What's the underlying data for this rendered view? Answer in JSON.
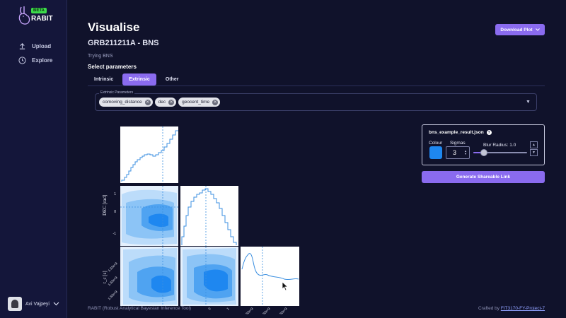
{
  "app": {
    "logo_text": "RABIT",
    "beta_badge": "BETA"
  },
  "sidebar": {
    "items": [
      {
        "label": "Upload",
        "icon": "upload-icon"
      },
      {
        "label": "Explore",
        "icon": "explore-icon"
      }
    ],
    "user": {
      "name": "Avi Vajpeyi"
    }
  },
  "header": {
    "title": "Visualise",
    "download_label": "Download Plot"
  },
  "main": {
    "subtitle": "GRB211211A - BNS",
    "description": "Trying BNS",
    "select_label": "Select parameters",
    "tabs": [
      {
        "label": "Intrinsic",
        "active": false
      },
      {
        "label": "Extrinsic",
        "active": true
      },
      {
        "label": "Other",
        "active": false
      }
    ],
    "param_legend": "Extrinsic Parameters",
    "chips": [
      "comoving_distance",
      "dec",
      "geocent_time"
    ]
  },
  "plot": {
    "ylabel_dec": "DEC [rad]",
    "ylabel_tc": "t_c [s]",
    "dec_ticks": [
      "1",
      "0",
      "-1"
    ],
    "tc_ticks": [
      "1.32e+9",
      "1.32e+9",
      "1.32e+9"
    ],
    "x_ticks_mid": [
      "0",
      "1"
    ],
    "x_ticks_right": [
      "1.32e+9",
      "1.32e+9",
      "1.32e+9"
    ],
    "colors": {
      "dark": "#1e87f0",
      "mid": "#6fb3f5",
      "light": "#bcdcfa",
      "pale": "#e6f1fd"
    }
  },
  "panel": {
    "filename": "bns_example_result.json",
    "colour_label": "Colour",
    "colour_value": "#1e87f0",
    "sigmas_label": "Sigmas",
    "sigmas_value": "3",
    "blur_label": "Blur Radius: 1.0",
    "blur_value": 1.0,
    "share_label": "Generate Shareable Link"
  },
  "footer": {
    "left": "RABIT (Robust Analytical Bayesian Inference Tool)",
    "right_prefix": "Crafted by",
    "right_link": "FIT3170-FY-Project-7"
  }
}
